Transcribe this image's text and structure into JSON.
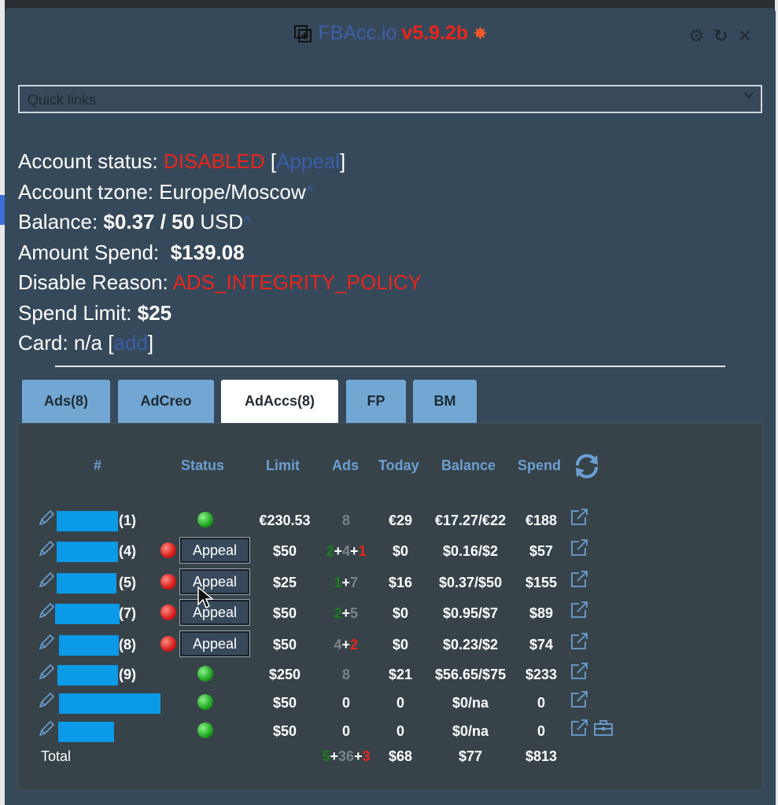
{
  "header": {
    "app_name": "FBAcc.io",
    "version": "v5.9.2b",
    "icons": [
      "copy-icon",
      "burst-icon",
      "gear-icon",
      "refresh-icon",
      "close-icon"
    ]
  },
  "quick_links": {
    "selected": "Quick links"
  },
  "account": {
    "status_label": "Account status:",
    "status_value": "DISABLED",
    "appeal_link": "Appeal",
    "tzone_label": "Account tzone:",
    "tzone_value": "Europe/Moscow",
    "caret": "^",
    "balance_label": "Balance:",
    "balance_value": "$0.37 / 50",
    "balance_currency": "USD",
    "spend_label": "Amount Spend:",
    "spend_value": "$139.08",
    "reason_label": "Disable Reason:",
    "reason_value": "ADS_INTEGRITY_POLICY",
    "limit_label": "Spend Limit:",
    "limit_value": "$25",
    "card_label": "Card:",
    "card_value": "n/a",
    "card_add": "add"
  },
  "tabs": [
    "Ads(8)",
    "AdCreo",
    "AdAccs(8)",
    "FP",
    "BM"
  ],
  "active_tab": "AdAccs(8)",
  "table": {
    "headers": [
      "#",
      "Status",
      "Limit",
      "Ads",
      "Today",
      "Balance",
      "Spend"
    ],
    "rows": [
      {
        "num": "(1)",
        "status": "green",
        "appeal": "",
        "limit": "€230.53",
        "ads": [
          {
            "v": "8",
            "c": "gr"
          }
        ],
        "today": "€29",
        "balance": "€17.27/€22",
        "spend": "€188"
      },
      {
        "num": "(4)",
        "status": "red",
        "appeal": "Appeal",
        "limit": "$50",
        "ads": [
          {
            "v": "2",
            "c": "g"
          },
          {
            "v": "+",
            "c": "w"
          },
          {
            "v": "4",
            "c": "gr"
          },
          {
            "v": "+",
            "c": "w"
          },
          {
            "v": "1",
            "c": "r"
          }
        ],
        "today": "$0",
        "balance": "$0.16/$2",
        "spend": "$57"
      },
      {
        "num": "(5)",
        "status": "red",
        "appeal": "Appeal",
        "limit": "$25",
        "ads": [
          {
            "v": "1",
            "c": "g"
          },
          {
            "v": "+",
            "c": "w"
          },
          {
            "v": "7",
            "c": "gr"
          }
        ],
        "today": "$16",
        "balance": "$0.37/$50",
        "spend": "$155"
      },
      {
        "num": "(7)",
        "status": "red",
        "appeal": "Appeal",
        "limit": "$50",
        "ads": [
          {
            "v": "2",
            "c": "g"
          },
          {
            "v": "+",
            "c": "w"
          },
          {
            "v": "5",
            "c": "gr"
          }
        ],
        "today": "$0",
        "balance": "$0.95/$7",
        "spend": "$89"
      },
      {
        "num": "(8)",
        "status": "red",
        "appeal": "Appeal",
        "limit": "$50",
        "ads": [
          {
            "v": "4",
            "c": "gr"
          },
          {
            "v": "+",
            "c": "w"
          },
          {
            "v": "2",
            "c": "r"
          }
        ],
        "today": "$0",
        "balance": "$0.23/$2",
        "spend": "$74"
      },
      {
        "num": "(9)",
        "status": "green",
        "appeal": "",
        "limit": "$250",
        "ads": [
          {
            "v": "8",
            "c": "gr"
          }
        ],
        "today": "$21",
        "balance": "$56.65/$75",
        "spend": "$233"
      },
      {
        "num": "",
        "status": "green",
        "appeal": "",
        "limit": "$50",
        "ads": [
          {
            "v": "0",
            "c": "w"
          }
        ],
        "today": "0",
        "balance": "$0/na",
        "spend": "0"
      },
      {
        "num": "",
        "status": "green",
        "appeal": "",
        "limit": "$50",
        "ads": [
          {
            "v": "0",
            "c": "w"
          }
        ],
        "today": "0",
        "balance": "$0/na",
        "spend": "0",
        "kit": true
      }
    ],
    "total": {
      "label": "Total",
      "ads": [
        {
          "v": "5",
          "c": "g"
        },
        {
          "v": "+",
          "c": "w"
        },
        {
          "v": "36",
          "c": "gr"
        },
        {
          "v": "+",
          "c": "w"
        },
        {
          "v": "3",
          "c": "r"
        }
      ],
      "today": "$68",
      "balance": "$77",
      "spend": "$813"
    }
  },
  "colors": {
    "panel": "#36495a",
    "accent_blue": "#6b9fd2",
    "danger": "#e8261c",
    "tab": "#72a7d3"
  }
}
